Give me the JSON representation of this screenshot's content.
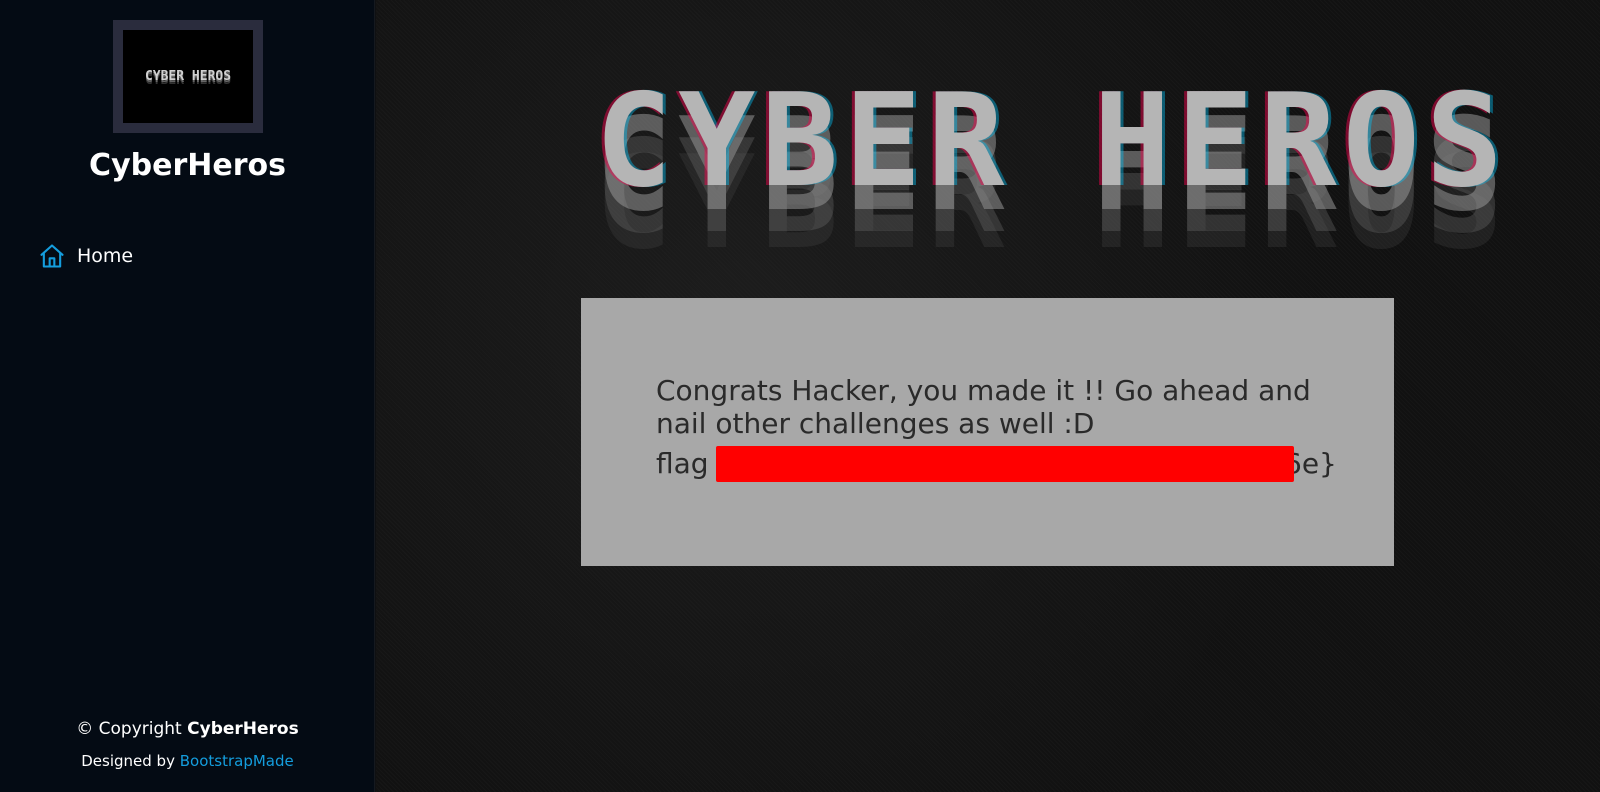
{
  "sidebar": {
    "logo_text": "CYBER HEROS",
    "brand": "CyberHeros",
    "nav": [
      {
        "label": "Home",
        "icon": "house-icon",
        "active": true
      }
    ],
    "footer": {
      "copyright_prefix": "© Copyright",
      "copyright_brand": "CyberHeros",
      "designed_prefix": "Designed by",
      "designed_link": "BootstrapMade"
    }
  },
  "main": {
    "banner_text": "CYBER HEROS",
    "message": "Congrats Hacker, you made it !! Go ahead and nail other challenges as well :D",
    "flag_prefix": "flag",
    "flag_suffix": "6e}",
    "flag_redaction_color": "#ff0000"
  },
  "colors": {
    "sidebar_bg": "#040b14",
    "accent": "#149ddd",
    "card_bg": "#a8a8a8"
  }
}
